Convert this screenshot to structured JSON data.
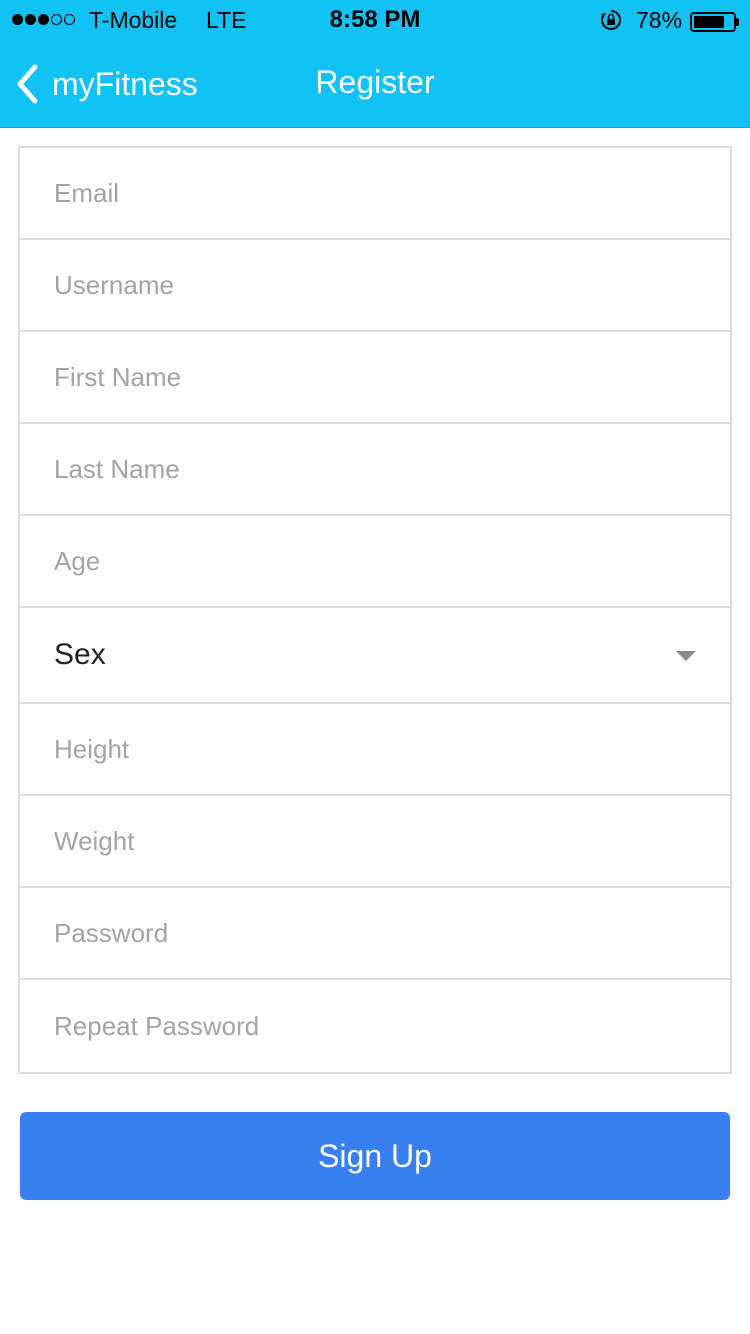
{
  "status_bar": {
    "carrier": "T-Mobile",
    "network": "LTE",
    "time": "8:58 PM",
    "battery_percent": "78%",
    "battery_level": 0.78,
    "signal_bars_filled": 3,
    "signal_bars_total": 5
  },
  "nav": {
    "back_label": "myFitness",
    "title": "Register"
  },
  "form": {
    "fields": [
      {
        "placeholder": "Email"
      },
      {
        "placeholder": "Username"
      },
      {
        "placeholder": "First Name"
      },
      {
        "placeholder": "Last Name"
      },
      {
        "placeholder": "Age"
      }
    ],
    "sex": {
      "value": "Sex"
    },
    "fields2": [
      {
        "placeholder": "Height"
      },
      {
        "placeholder": "Weight"
      },
      {
        "placeholder": "Password"
      },
      {
        "placeholder": "Repeat Password"
      }
    ]
  },
  "actions": {
    "signup_label": "Sign Up"
  },
  "colors": {
    "header": "#12c2f4",
    "button": "#3880f1",
    "border": "#dcdcdc",
    "placeholder": "#a4a4a4"
  },
  "icons": [
    "back-chevron-icon",
    "orientation-lock-icon",
    "battery-icon",
    "dropdown-caret-icon"
  ]
}
